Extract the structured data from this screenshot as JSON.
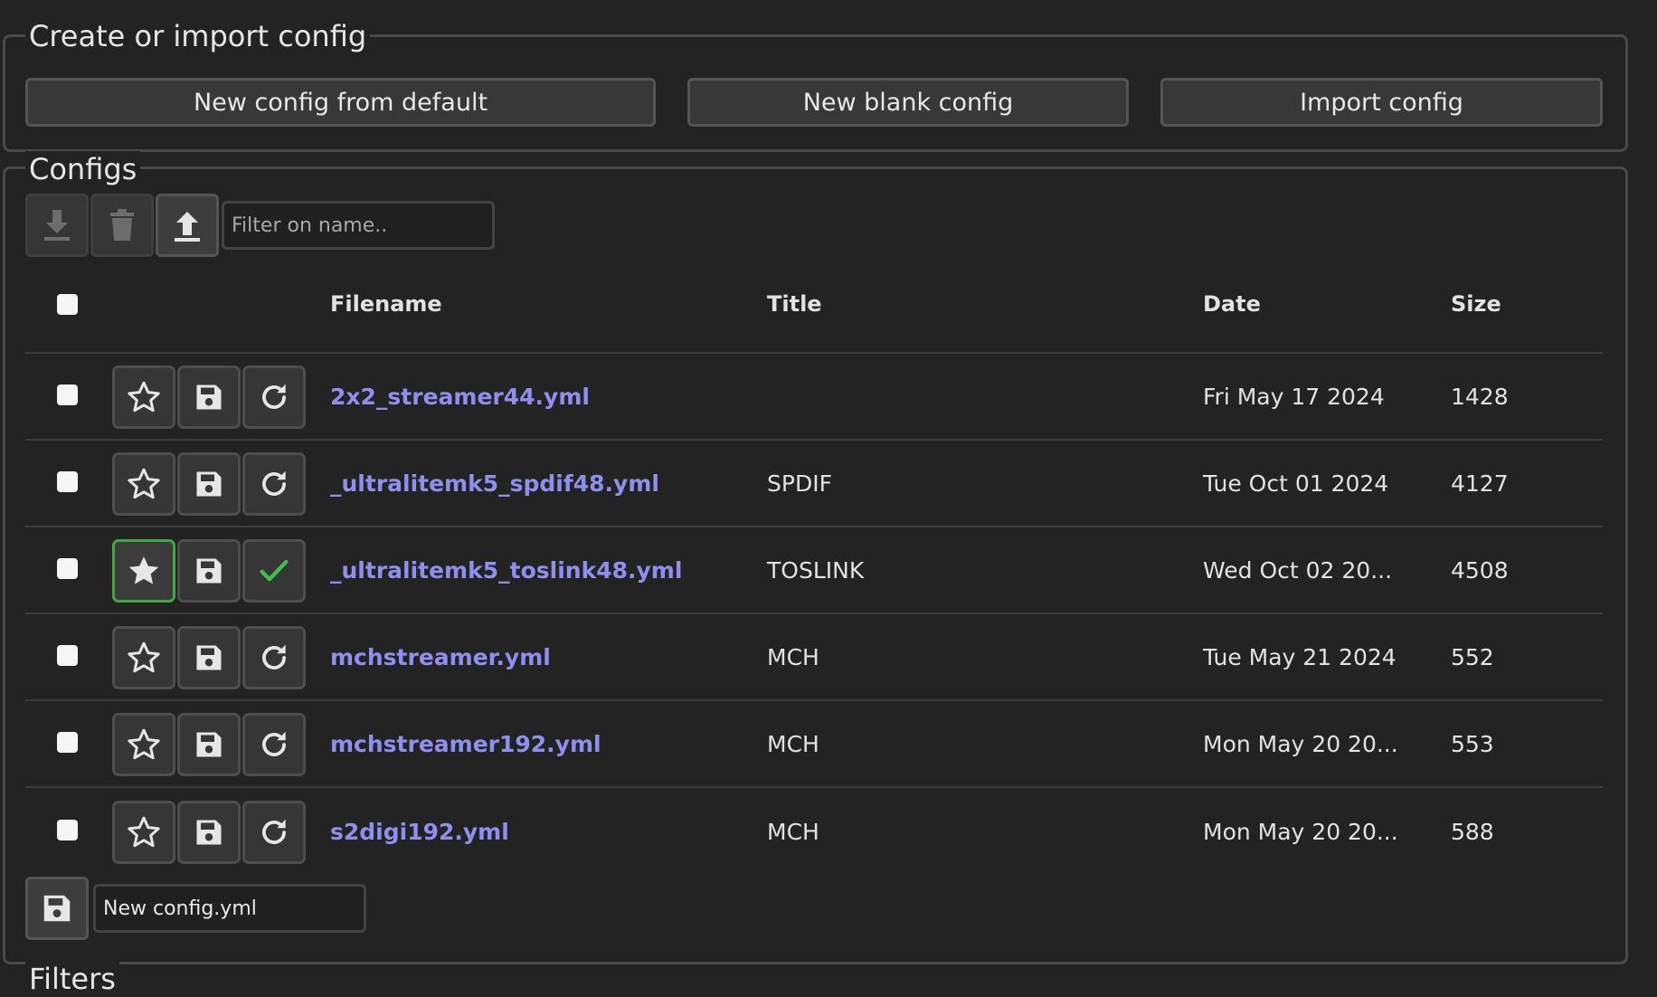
{
  "create_section": {
    "legend": "Create or import config",
    "buttons": {
      "from_default": "New config from default",
      "blank": "New blank config",
      "import": "Import config"
    }
  },
  "configs_section": {
    "legend": "Configs",
    "filter_placeholder": "Filter on name..",
    "columns": {
      "filename": "Filename",
      "title": "Title",
      "date": "Date",
      "size": "Size"
    },
    "rows": [
      {
        "filename": "2x2_streamer44.yml",
        "title": "",
        "date": "Fri May 17 2024",
        "size": "1428",
        "active": false
      },
      {
        "filename": "_ultralitemk5_spdif48.yml",
        "title": "SPDIF",
        "date": "Tue Oct 01 2024",
        "size": "4127",
        "active": false
      },
      {
        "filename": "_ultralitemk5_toslink48.yml",
        "title": "TOSLINK",
        "date": "Wed Oct 02 20...",
        "size": "4508",
        "active": true
      },
      {
        "filename": "mchstreamer.yml",
        "title": "MCH",
        "date": "Tue May 21 2024",
        "size": "552",
        "active": false
      },
      {
        "filename": "mchstreamer192.yml",
        "title": "MCH",
        "date": "Mon May 20 20...",
        "size": "553",
        "active": false
      },
      {
        "filename": "s2digi192.yml",
        "title": "MCH",
        "date": "Mon May 20 20...",
        "size": "588",
        "active": false
      }
    ],
    "new_config_name": "New config.yml"
  },
  "next_section_legend": "Filters",
  "colors": {
    "background": "#232323",
    "link": "#8f8ff0",
    "active_border": "#3fa844",
    "checkmark": "#3fbf4a"
  }
}
